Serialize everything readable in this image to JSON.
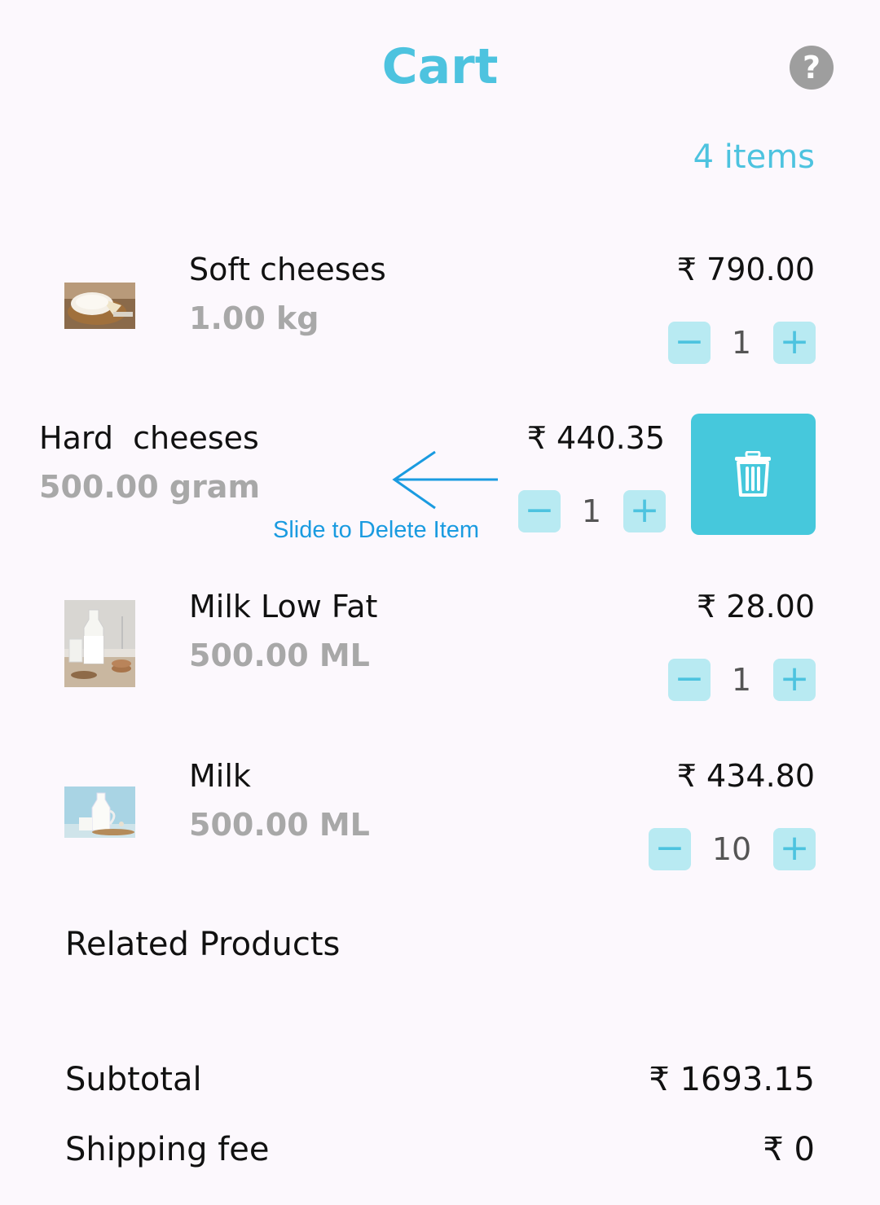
{
  "header": {
    "title": "Cart",
    "help_icon": "help-circle-icon",
    "help_glyph": "?",
    "item_count": "4 items"
  },
  "items": [
    {
      "name": "Soft cheeses",
      "quantity_label": "1.00 kg",
      "price": "₹ 790.00",
      "count": "1",
      "image": "soft-cheese-photo"
    },
    {
      "name": "Hard  cheeses",
      "quantity_label": "500.00 gram",
      "price": "₹ 440.35",
      "count": "1",
      "slid_open": true
    },
    {
      "name": "Milk Low Fat",
      "quantity_label": "500.00 ML",
      "price": "₹ 28.00",
      "count": "1",
      "image": "milk-bottle-photo"
    },
    {
      "name": "Milk",
      "quantity_label": "500.00 ML",
      "price": "₹ 434.80",
      "count": "10",
      "image": "milk-jug-photo"
    }
  ],
  "stepper": {
    "minus": "−",
    "plus": "+"
  },
  "swipe_hint": {
    "text": "Slide to Delete Item",
    "arrow_icon": "arrow-left-icon"
  },
  "delete_action": {
    "icon": "trash-icon",
    "color": "#46c8dc"
  },
  "related": {
    "title": "Related Products"
  },
  "summary": {
    "subtotal_label": "Subtotal",
    "subtotal_value": "₹ 1693.15",
    "shipping_label": "Shipping fee",
    "shipping_value": "₹ 0"
  },
  "colors": {
    "accent": "#4dc3df",
    "stepper_bg": "#b8eaf2",
    "muted": "#a8a8a8",
    "background": "#fcf8fd",
    "hint": "#1a9be0"
  }
}
